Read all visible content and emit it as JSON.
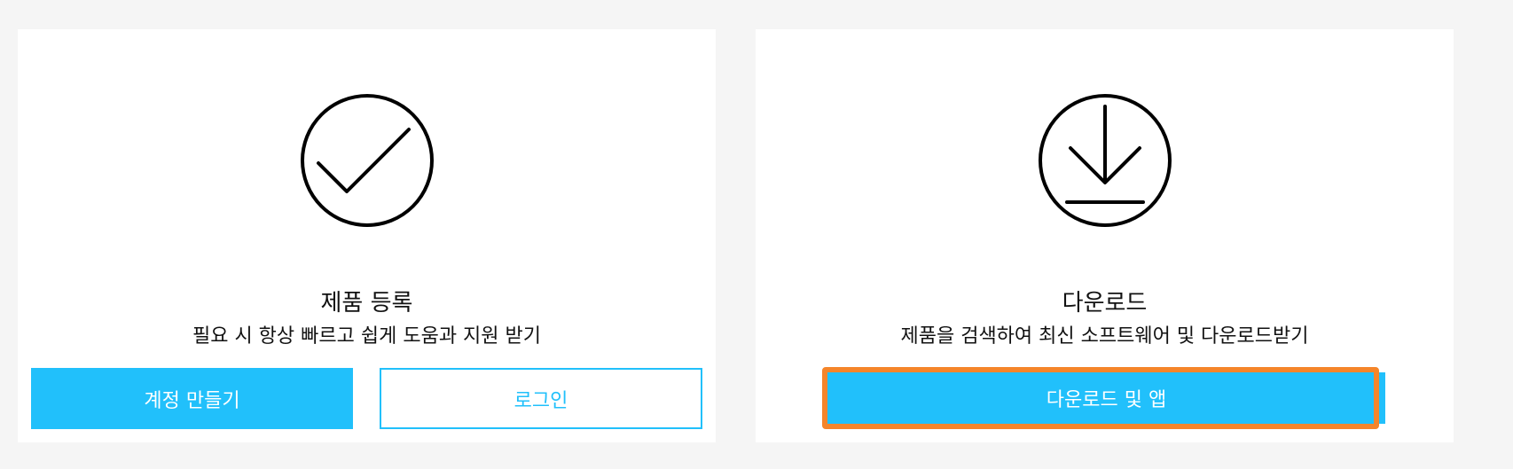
{
  "register_card": {
    "icon": "checkmark-circle-icon",
    "title": "제품 등록",
    "description": "필요 시 항상 빠르고 쉽게 도움과 지원 받기",
    "create_account_label": "계정 만들기",
    "login_label": "로그인"
  },
  "download_card": {
    "icon": "download-circle-icon",
    "title": "다운로드",
    "description": "제품을 검색하여 최신 소프트웨어 및 다운로드받기",
    "download_button_label": "다운로드 및 앱"
  },
  "colors": {
    "accent": "#21c0fb",
    "highlight": "#f5852a",
    "background": "#f5f5f5",
    "card": "#ffffff"
  }
}
